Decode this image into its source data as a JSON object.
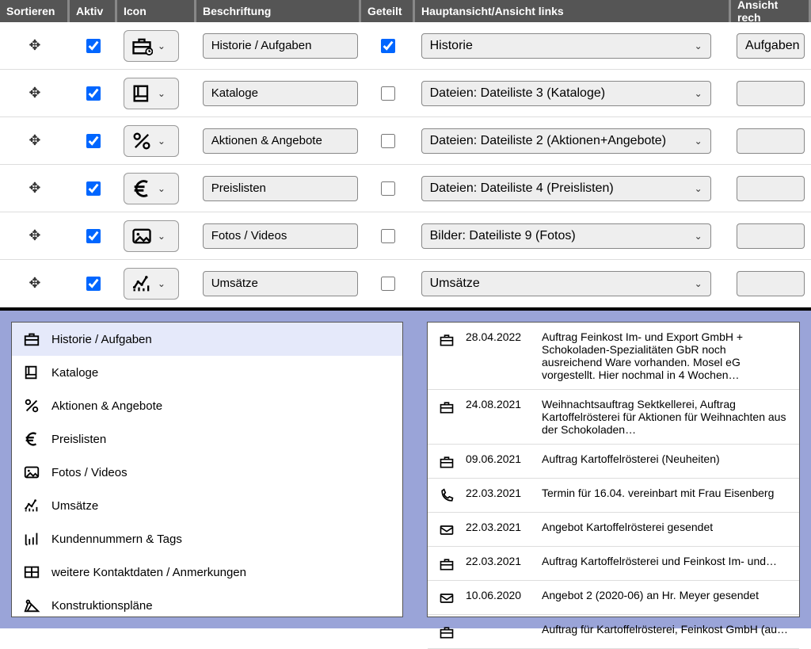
{
  "headers": {
    "sort": "Sortieren",
    "aktiv": "Aktiv",
    "icon": "Icon",
    "besch": "Beschriftung",
    "geteilt": "Geteilt",
    "haupt": "Hauptansicht/Ansicht links",
    "rechts": "Ansicht rech"
  },
  "rows": [
    {
      "aktiv": true,
      "geteilt": true,
      "label": "Historie / Aufgaben",
      "haupt": "Historie",
      "rechts": "Aufgaben",
      "iconKey": "briefcase-clock"
    },
    {
      "aktiv": true,
      "geteilt": false,
      "label": "Kataloge",
      "haupt": "Dateien: Dateiliste 3 (Kataloge)",
      "rechts": "",
      "iconKey": "book"
    },
    {
      "aktiv": true,
      "geteilt": false,
      "label": "Aktionen & Angebote",
      "haupt": "Dateien: Dateiliste 2 (Aktionen+Angebote)",
      "rechts": "",
      "iconKey": "percent"
    },
    {
      "aktiv": true,
      "geteilt": false,
      "label": "Preislisten",
      "haupt": "Dateien: Dateiliste 4 (Preislisten)",
      "rechts": "",
      "iconKey": "euro"
    },
    {
      "aktiv": true,
      "geteilt": false,
      "label": "Fotos / Videos",
      "haupt": "Bilder: Dateiliste 9 (Fotos)",
      "rechts": "",
      "iconKey": "image"
    },
    {
      "aktiv": true,
      "geteilt": false,
      "label": "Umsätze",
      "haupt": "Umsätze",
      "rechts": "",
      "iconKey": "chart"
    }
  ],
  "nav": [
    {
      "label": "Historie / Aufgaben",
      "iconKey": "briefcase",
      "selected": true
    },
    {
      "label": "Kataloge",
      "iconKey": "book"
    },
    {
      "label": "Aktionen & Angebote",
      "iconKey": "percent"
    },
    {
      "label": "Preislisten",
      "iconKey": "euro"
    },
    {
      "label": "Fotos / Videos",
      "iconKey": "image"
    },
    {
      "label": "Umsätze",
      "iconKey": "chart"
    },
    {
      "label": "Kundennummern & Tags",
      "iconKey": "bars"
    },
    {
      "label": "weitere Kontaktdaten / Anmerkungen",
      "iconKey": "grid"
    },
    {
      "label": "Konstruktionspläne",
      "iconKey": "compass"
    }
  ],
  "history": [
    {
      "date": "28.04.2022",
      "text": "Auftrag Feinkost Im- und Export GmbH + Schokoladen-Spezialitäten GbR noch ausreichend Ware vorhanden. Mosel eG vorgestellt. Hier nochmal in 4 Wochen…",
      "iconKey": "briefcase",
      "multiline": true
    },
    {
      "date": "24.08.2021",
      "text": "Weihnachtsauftrag Sektkellerei, Auftrag Kartoffelrösterei für Aktionen für Weihnachten aus der Schokoladen…",
      "iconKey": "briefcase",
      "multiline": true
    },
    {
      "date": "09.06.2021",
      "text": "Auftrag Kartoffelrösterei (Neuheiten)",
      "iconKey": "briefcase"
    },
    {
      "date": "22.03.2021",
      "text": "Termin für 16.04. vereinbart mit Frau Eisenberg",
      "iconKey": "phone"
    },
    {
      "date": "22.03.2021",
      "text": "Angebot Kartoffelrösterei gesendet",
      "iconKey": "envelope"
    },
    {
      "date": "22.03.2021",
      "text": "Auftrag Kartoffelrösterei und Feinkost Im- und…",
      "iconKey": "briefcase"
    },
    {
      "date": "10.06.2020",
      "text": "Angebot 2 (2020-06) an Hr. Meyer gesendet",
      "iconKey": "envelope"
    },
    {
      "date": "",
      "text": "Auftrag für Kartoffelrösterei, Feinkost GmbH (au…",
      "iconKey": "briefcase"
    }
  ]
}
